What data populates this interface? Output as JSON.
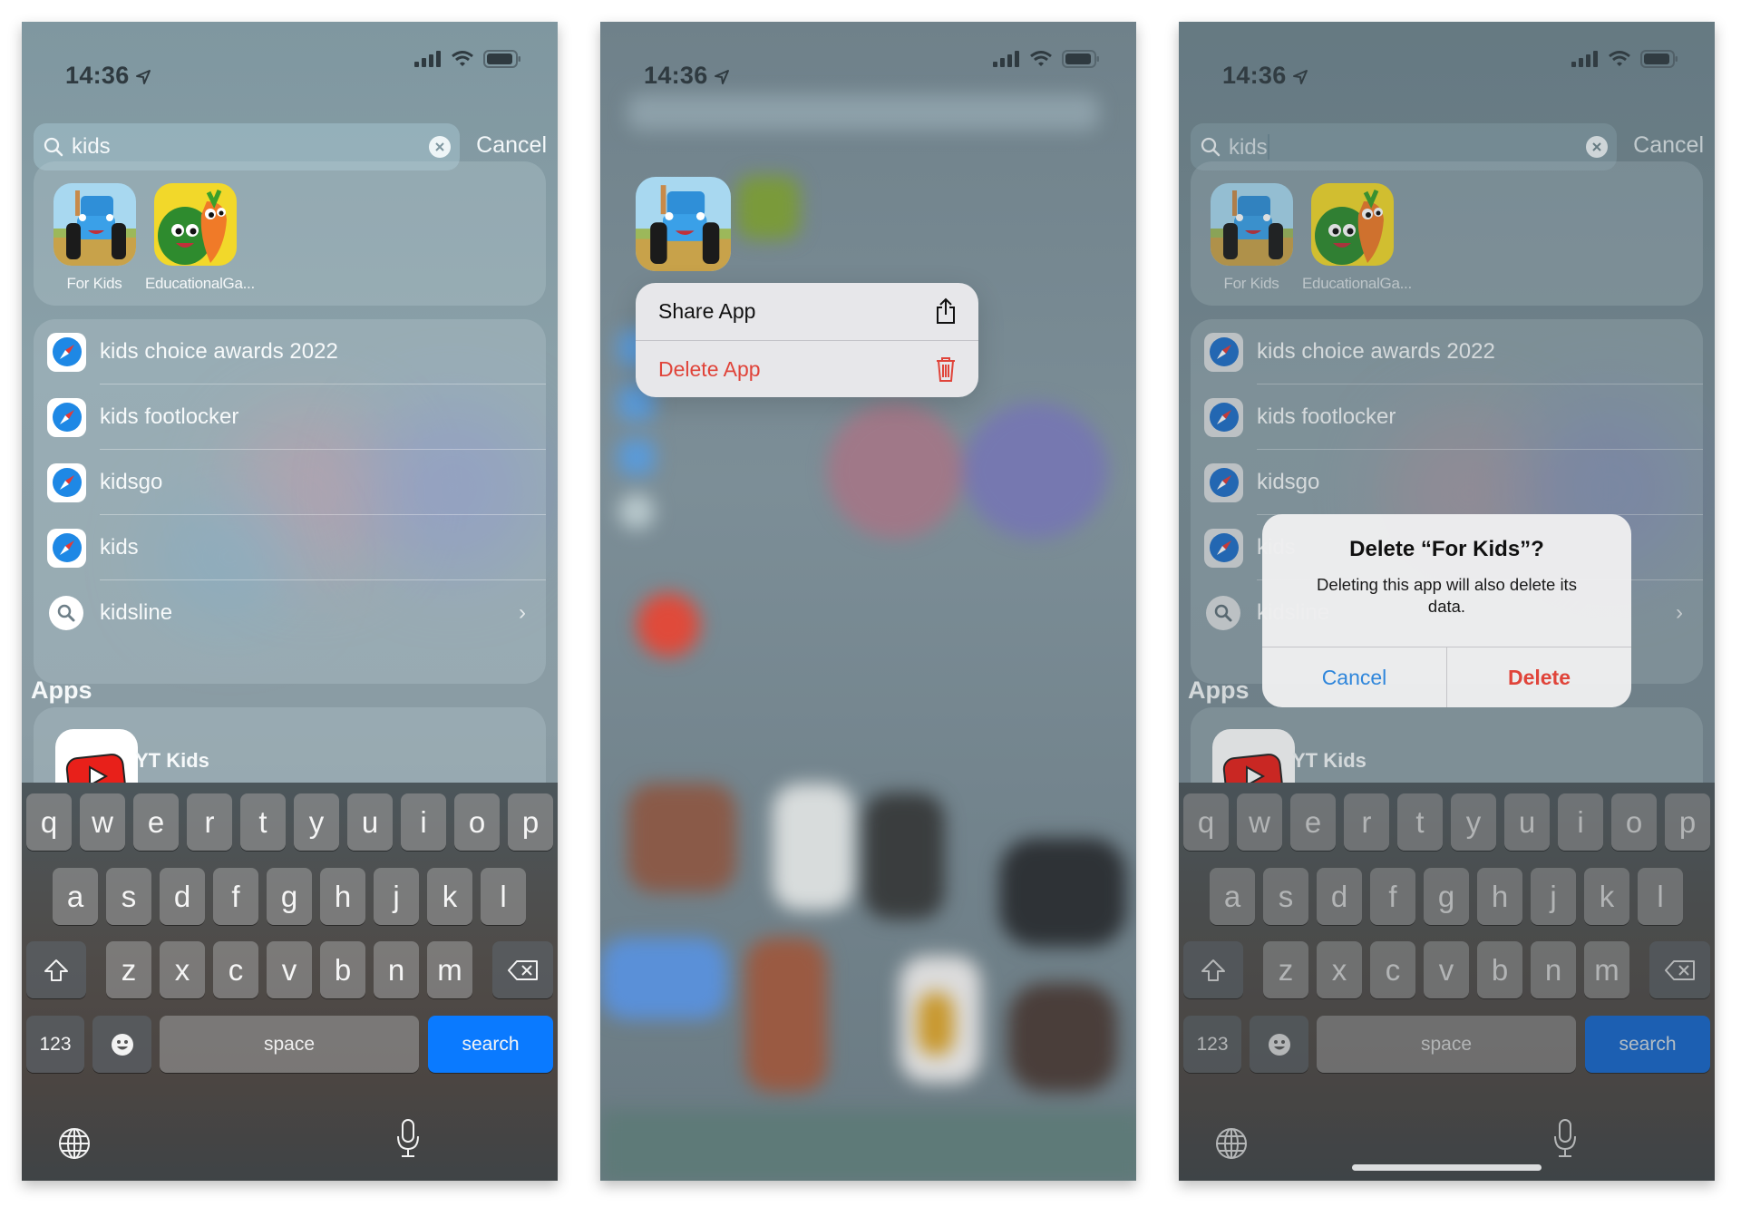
{
  "status_bar": {
    "time": "14:36"
  },
  "search": {
    "query": "kids",
    "placeholder": "",
    "cancel_label": "Cancel"
  },
  "top_apps": [
    {
      "label": "For Kids",
      "icon": "tractor-app-icon"
    },
    {
      "label": "EducationalGa...",
      "icon": "veggies-app-icon"
    }
  ],
  "suggestions": [
    {
      "text": "kids choice awards 2022",
      "icon": "safari-icon"
    },
    {
      "text": "kids footlocker",
      "icon": "safari-icon"
    },
    {
      "text": "kidsgo",
      "icon": "safari-icon"
    },
    {
      "text": "kids",
      "icon": "safari-icon"
    },
    {
      "text": "kidsline",
      "icon": "search-icon",
      "has_chevron": true
    }
  ],
  "apps_section": {
    "heading": "Apps",
    "items": [
      {
        "label": "YT Kids",
        "icon": "youtube-kids-icon"
      }
    ]
  },
  "keyboard": {
    "row1": [
      "q",
      "w",
      "e",
      "r",
      "t",
      "y",
      "u",
      "i",
      "o",
      "p"
    ],
    "row2": [
      "a",
      "s",
      "d",
      "f",
      "g",
      "h",
      "j",
      "k",
      "l"
    ],
    "row3": [
      "z",
      "x",
      "c",
      "v",
      "b",
      "n",
      "m"
    ],
    "numbers_label": "123",
    "space_label": "space",
    "return_label": "search",
    "return_color": "#0a7aff"
  },
  "context_menu": {
    "items": [
      {
        "label": "Share App",
        "icon": "share-icon",
        "color": "#111111"
      },
      {
        "label": "Delete App",
        "icon": "trash-icon",
        "color": "#e0443a"
      }
    ]
  },
  "delete_dialog": {
    "title": "Delete “For Kids”?",
    "message": "Deleting this app will also delete its data.",
    "cancel_label": "Cancel",
    "delete_label": "Delete",
    "cancel_color": "#2f86db",
    "delete_color": "#e0443a"
  },
  "accent_colors": {
    "keyboard_blue": "#0a7aff",
    "destructive_red": "#e0443a"
  }
}
